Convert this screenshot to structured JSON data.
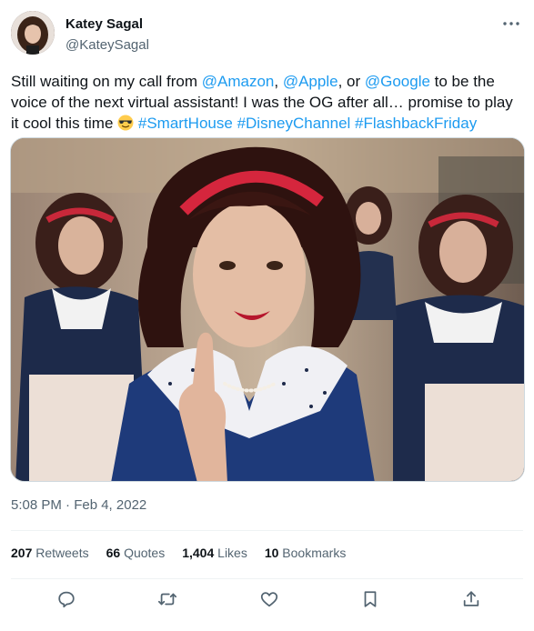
{
  "author": {
    "name": "Katey Sagal",
    "handle": "@KateySagal"
  },
  "tweet": {
    "text_1": "Still waiting on my call from ",
    "mention_1": "@Amazon",
    "sep_1": ", ",
    "mention_2": "@Apple",
    "sep_2": ", or ",
    "mention_3": "@Google",
    "text_2": " to be the voice of the next virtual assistant! I was the OG after all… promise to play it cool this time ",
    "emoji": "smiling-face-with-sunglasses",
    "hashtag_1": "#SmartHouse",
    "hashtag_2": "#DisneyChannel",
    "hashtag_3": "#FlashbackFriday"
  },
  "timestamp": "5:08 PM · Feb 4, 2022",
  "stats": {
    "retweets_count": "207",
    "retweets_label": " Retweets",
    "quotes_count": "66",
    "quotes_label": " Quotes",
    "likes_count": "1,404",
    "likes_label": " Likes",
    "bookmarks_count": "10",
    "bookmarks_label": " Bookmarks"
  },
  "icons": [
    "more-icon",
    "reply-icon",
    "retweet-icon",
    "like-icon",
    "bookmark-icon",
    "share-icon"
  ],
  "colors": {
    "link": "#1d9bf0",
    "text": "#0f1419",
    "secondary": "#536471",
    "divider": "#eff3f4"
  }
}
